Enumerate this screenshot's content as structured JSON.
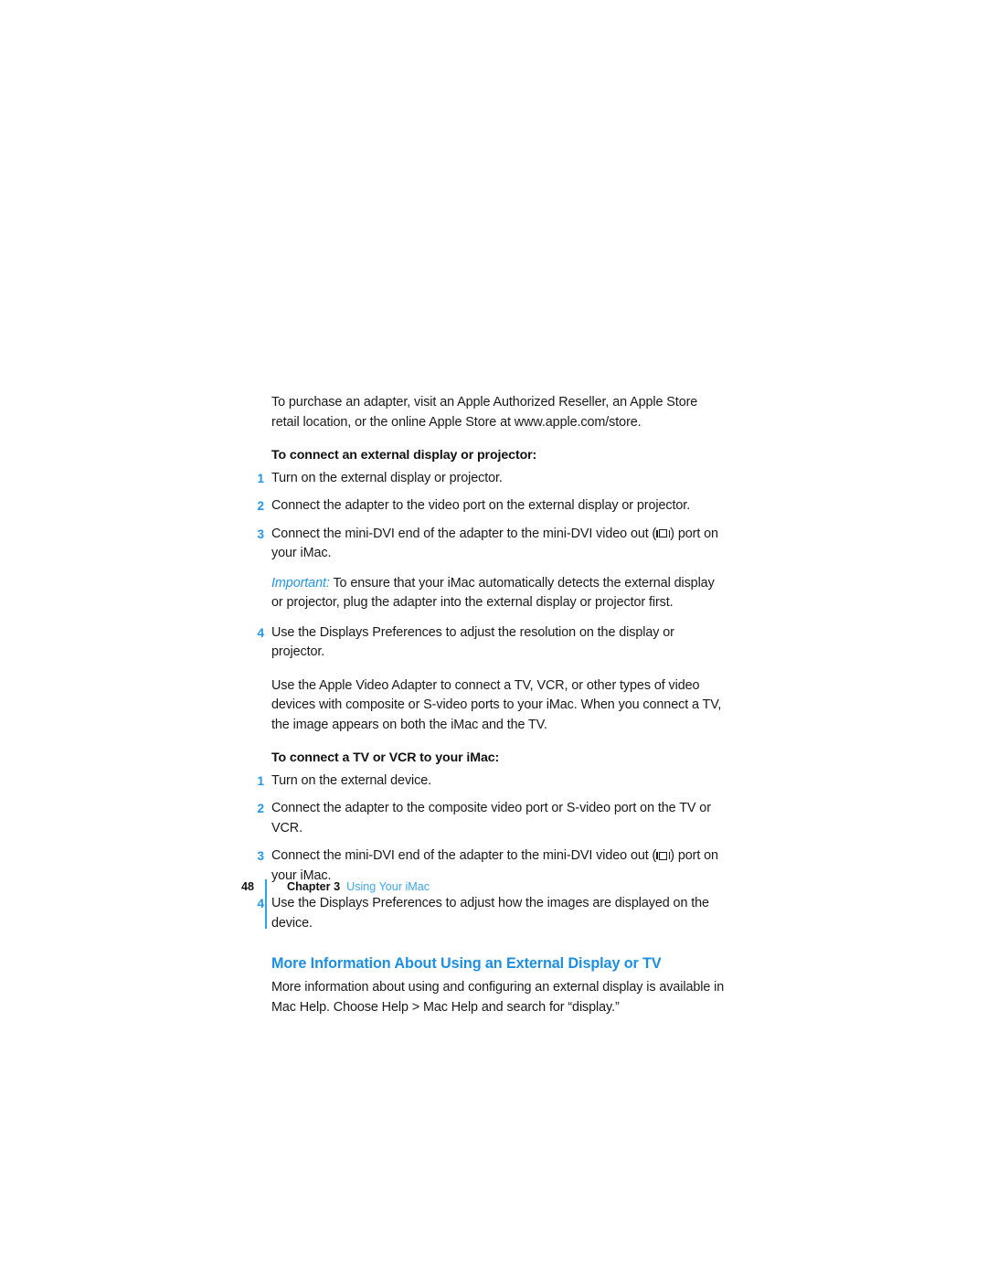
{
  "page": {
    "intro_paragraph": "To purchase an adapter, visit an Apple Authorized Reseller, an Apple Store retail location, or the online Apple Store at www.apple.com/store.",
    "accent_blue": "#2196e8",
    "heading_blue": "#1b8fe3",
    "body_color": "#1a1a1a"
  },
  "display_procedure": {
    "subhead": "To connect an external display or projector:",
    "steps": [
      {
        "num": "1",
        "text": "Turn on the external display or projector."
      },
      {
        "num": "2",
        "text": "Connect the adapter to the video port on the external display or projector."
      },
      {
        "num": "3",
        "text_before_icon": "Connect the mini-DVI end of the adapter to the mini-DVI video out (",
        "icon": "mini-dvi-port-icon",
        "text_after_icon": ") port on your iMac."
      },
      {
        "num": "4",
        "text": "Use the Displays Preferences to adjust the resolution on the display or projector."
      }
    ],
    "note": {
      "label": "Important:",
      "text": "To ensure that your iMac automatically detects the external display or projector, plug the adapter into the external display or projector first."
    }
  },
  "video_adapter_paragraph": "Use the Apple Video Adapter to connect a TV, VCR, or other types of video devices with composite or S-video ports to your iMac. When you connect a TV, the image appears on both the iMac and the TV.",
  "tv_procedure": {
    "subhead": "To connect a TV or VCR to your iMac:",
    "steps": [
      {
        "num": "1",
        "text": "Turn on the external device."
      },
      {
        "num": "2",
        "text": "Connect the adapter to the composite video port or S-video port on the TV or VCR."
      },
      {
        "num": "3",
        "text_before_icon": "Connect the mini-DVI end of the adapter to the mini-DVI video out (",
        "icon": "mini-dvi-port-icon",
        "text_after_icon": ") port on your iMac."
      },
      {
        "num": "4",
        "text": "Use the Displays Preferences to adjust how the images are displayed on the device."
      }
    ]
  },
  "more_info": {
    "heading": "More Information About Using an External Display or TV",
    "body": "More information about using and configuring an external display is available in Mac Help. Choose Help > Mac Help and search for “display.”"
  },
  "footer": {
    "page_number": "48",
    "chapter": "Chapter 3",
    "chapter_title": "Using Your iMac",
    "rule_color": "#29a3f0"
  }
}
